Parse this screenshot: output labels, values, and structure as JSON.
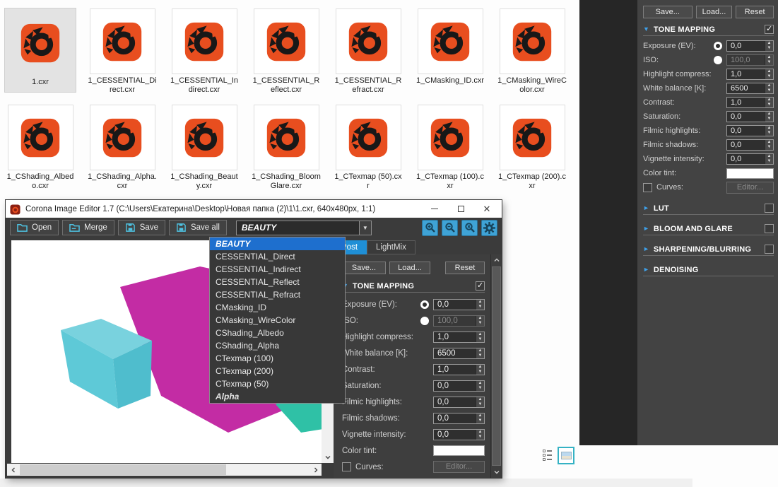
{
  "colors": {
    "corona_orange": "#e84e1f",
    "selection_blue": "#1e6fce",
    "tab_blue": "#1f8fd6",
    "accent_triangle_blue": "#3fa0e8",
    "panel_bg": "#434343",
    "toolbar_icon_blue": "#3fa3d6",
    "canvas_magenta": "#c32ca4",
    "canvas_cyan": "#5ec9d7",
    "canvas_teal": "#2fc1a6"
  },
  "file_browser": {
    "files_row1": [
      {
        "name": "1.cxr",
        "selected": true
      },
      {
        "name": "1_CESSENTIAL_Direct.cxr"
      },
      {
        "name": "1_CESSENTIAL_Indirect.cxr"
      },
      {
        "name": "1_CESSENTIAL_Reflect.cxr"
      },
      {
        "name": "1_CESSENTIAL_Refract.cxr"
      },
      {
        "name": "1_CMasking_ID.cxr"
      },
      {
        "name": "1_CMasking_WireColor.cxr"
      }
    ],
    "files_row2": [
      {
        "name": "1_CShading_Albedo.cxr"
      },
      {
        "name": "1_CShading_Alpha.cxr"
      },
      {
        "name": "1_CShading_Beauty.cxr"
      },
      {
        "name": "1_CShading_BloomGlare.cxr"
      },
      {
        "name": "1_CTexmap (50).cxr"
      },
      {
        "name": "1_CTexmap (100).cxr"
      },
      {
        "name": "1_CTexmap (200).cxr"
      }
    ],
    "view_icons": [
      "details-view",
      "thumbnails-view"
    ]
  },
  "editor": {
    "title": "Corona Image Editor 1.7 (C:\\Users\\Екатерина\\Desktop\\Новая папка (2)\\1\\1.cxr, 640x480px, 1:1)",
    "window_buttons": [
      "minimize",
      "maximize",
      "close"
    ],
    "toolbar": {
      "open": "Open",
      "merge": "Merge",
      "save": "Save",
      "save_all": "Save all"
    },
    "toolbar_icons": {
      "open": "folder-open",
      "merge": "folder-merge",
      "save": "floppy-disk",
      "save_all": "floppy-disk",
      "zoom_in": "magnifier-plus",
      "zoom_out": "magnifier-minus",
      "zoom_reset": "magnifier-x",
      "settings": "gear"
    },
    "channel_dropdown": {
      "selected": "BEAUTY",
      "items": [
        {
          "label": "BEAUTY",
          "selected": true
        },
        {
          "label": "CESSENTIAL_Direct"
        },
        {
          "label": "CESSENTIAL_Indirect"
        },
        {
          "label": "CESSENTIAL_Reflect"
        },
        {
          "label": "CESSENTIAL_Refract"
        },
        {
          "label": "CMasking_ID"
        },
        {
          "label": "CMasking_WireColor"
        },
        {
          "label": "CShading_Albedo"
        },
        {
          "label": "CShading_Alpha"
        },
        {
          "label": "CTexmap (100)"
        },
        {
          "label": "CTexmap (200)"
        },
        {
          "label": "CTexmap (50)"
        },
        {
          "label": "Alpha",
          "italic": true
        }
      ]
    },
    "tabs": [
      {
        "label": "Post",
        "active": true
      },
      {
        "label": "LightMix",
        "active": false
      }
    ]
  },
  "tone_mapping": {
    "buttons": [
      "Save...",
      "Load...",
      "Reset"
    ],
    "section_label": "TONE MAPPING",
    "section_checked": true,
    "spin_rows": [
      {
        "label": "Exposure (EV):",
        "value": "0,0",
        "radio": "ring",
        "disabled": false
      },
      {
        "label": "ISO:",
        "value": "100,0",
        "radio": "dot",
        "disabled": true
      },
      {
        "label": "Highlight compress:",
        "value": "1,0"
      },
      {
        "label": "White balance [K]:",
        "value": "6500"
      },
      {
        "label": "Contrast:",
        "value": "1,0"
      },
      {
        "label": "Saturation:",
        "value": "0,0"
      },
      {
        "label": "Filmic highlights:",
        "value": "0,0"
      },
      {
        "label": "Filmic shadows:",
        "value": "0,0"
      },
      {
        "label": "Vignette intensity:",
        "value": "0,0"
      }
    ],
    "color_tint_label": "Color tint:",
    "curves_label": "Curves:",
    "curves_checked": false,
    "curves_editor_button": "Editor...",
    "extra_sections": [
      {
        "label": "LUT",
        "checkbox": true
      },
      {
        "label": "BLOOM AND GLARE",
        "checkbox": true
      },
      {
        "label": "SHARPENING/BLURRING",
        "checkbox": true
      },
      {
        "label": "DENOISING",
        "checkbox": false
      }
    ]
  }
}
